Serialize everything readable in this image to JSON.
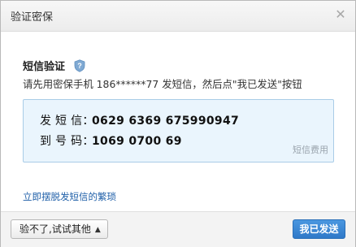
{
  "dialog": {
    "title": "验证密保",
    "close_icon": "close-icon"
  },
  "content": {
    "heading": "短信验证",
    "shield_icon": "shield-question-icon",
    "instruction": "请先用密保手机 186******77 发短信，然后点\"我已发送\"按钮",
    "sms": {
      "send_label": "发 短 信：",
      "send_value": "0629 6369 675990947",
      "to_label": "到 号 码：",
      "to_value": "1069 0700 69",
      "fee_note": "短信费用"
    },
    "link": "立即摆脱发短信的繁琐"
  },
  "footer": {
    "alt_button": "验不了,试试其他",
    "alt_caret_icon": "caret-up-icon",
    "primary_button": "我已发送"
  },
  "colors": {
    "accent": "#2f79c8",
    "link": "#1f5fa8",
    "sms_box_bg": "#eaf5fd",
    "sms_box_border": "#a9cce7",
    "shield": "#7fa9d3"
  }
}
